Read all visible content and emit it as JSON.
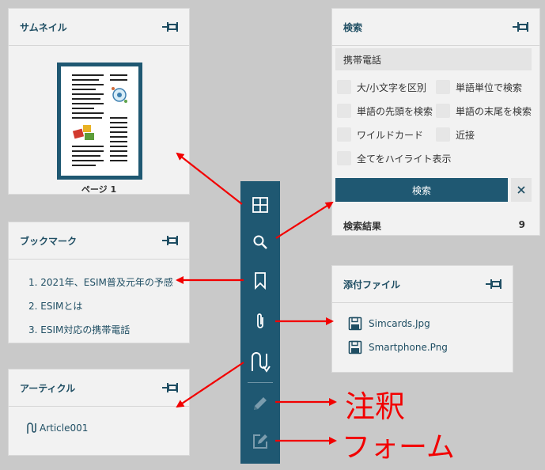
{
  "thumbnails": {
    "title": "サムネイル",
    "page_label": "ページ 1"
  },
  "bookmarks": {
    "title": "ブックマーク",
    "items": [
      "1. 2021年、ESIM普及元年の予感",
      "2. ESIMとは",
      "3. ESIM対応の携帯電話"
    ]
  },
  "articles": {
    "title": "アーティクル",
    "items": [
      "Article001"
    ]
  },
  "search": {
    "title": "検索",
    "query": "携帯電話",
    "options": [
      "大/小文字を区別",
      "単語単位で検索",
      "単語の先頭を検索",
      "単語の末尾を検索",
      "ワイルドカード",
      "近接",
      "全てをハイライト表示"
    ],
    "button_label": "検索",
    "results_label": "検索結果",
    "results_count": "9"
  },
  "attachments": {
    "title": "添付ファイル",
    "items": [
      "Simcards.Jpg",
      "Smartphone.Png"
    ]
  },
  "annotations": {
    "comments": "注釈",
    "forms": "フォーム"
  },
  "toolbar": {
    "buttons": [
      "thumbnails-icon",
      "search-icon",
      "bookmark-icon",
      "attachment-icon",
      "article-icon",
      "pen-icon",
      "form-edit-icon"
    ]
  },
  "colors": {
    "accent": "#1f5872",
    "arrow": "#f20000",
    "panel": "#f2f2f2",
    "background": "#c9c9c9"
  }
}
